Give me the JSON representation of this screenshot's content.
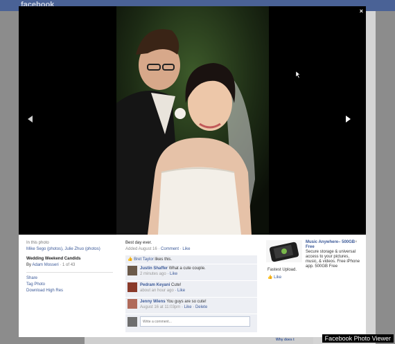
{
  "topbar": {
    "logo": "facebook"
  },
  "stage": {
    "close_glyph": "×",
    "prev_icon": "arrow-left-icon",
    "next_icon": "arrow-right-icon"
  },
  "left": {
    "in_photo_label": "In this photo",
    "tags": "Mike Sego (photos), Julie Zhuo (photos)",
    "album_title": "Wedding Weekend Candids",
    "by_prefix": "By",
    "owner": "Adam Mosseri",
    "position": "· 1 of 43",
    "actions": [
      "Share",
      "Tag Photo",
      "Download High Res"
    ]
  },
  "middle": {
    "caption": "Best day ever.",
    "added": "Added August 16",
    "added_links": "· Comment · Like",
    "likes": {
      "name": "Bret Taylor",
      "text": "likes this."
    },
    "comments": [
      {
        "name": "Justin Shaffer",
        "text": "What a cute couple.",
        "time": "2 minutes ago",
        "actions": "· Like"
      },
      {
        "name": "Pedram Keyani",
        "text": "Cute!",
        "time": "about an hour ago",
        "actions": "· Like"
      },
      {
        "name": "Jenny Wiens",
        "text": "You guys are so cute!",
        "time": "August 16 at 11:03pm",
        "actions": "· Like · Delete"
      }
    ],
    "write_placeholder": "Write a comment..."
  },
  "ad": {
    "title": "Music Anywhere– 500GB Free",
    "body": "Secure storage & universal access to your pictures, music, & videos. Free iPhone app. 500GB Free",
    "close": "×",
    "tagline": "Fastest Upload.",
    "like": "Like"
  },
  "page_bottom": {
    "why": "Why does t"
  },
  "watermark": "Facebook Photo Viewer",
  "colors": {
    "fb_blue": "#3b5998",
    "stage_bg": "#000000",
    "comment_bg": "#edeff4"
  }
}
